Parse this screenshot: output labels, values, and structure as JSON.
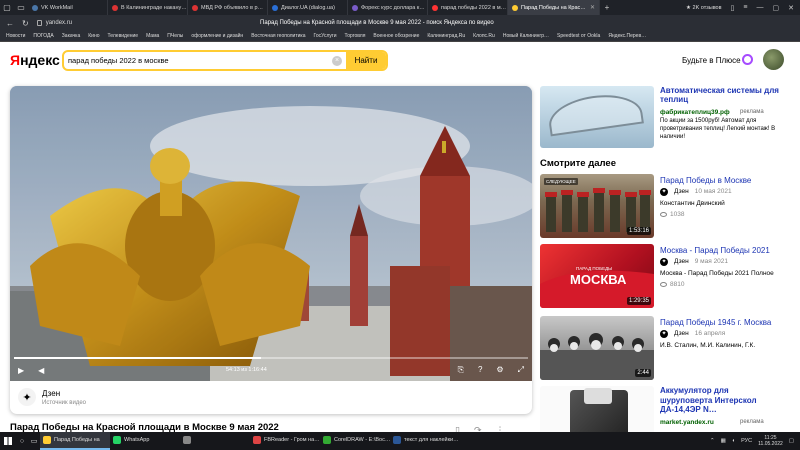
{
  "browser": {
    "tabs": [
      {
        "label": "VK WorkMail",
        "color": "#4a76a8"
      },
      {
        "label": "В Калининграде накану…",
        "color": "#d33"
      },
      {
        "label": "МВД РФ объявило в р…",
        "color": "#d33"
      },
      {
        "label": "Диалог.UA (dialog.ua)",
        "color": "#2a6fd6"
      },
      {
        "label": "Форекс курс доллара к…",
        "color": "#7a5cc9"
      },
      {
        "label": "парад победы 2022 в м…",
        "color": "#f33"
      },
      {
        "label": "Парад Победы на Крас…",
        "color": "#fc3"
      }
    ],
    "rating": "★ 2K отзывов",
    "url": "yandex.ru",
    "page_title": "Парад Победы на Красной площади в Москве 9 мая 2022 - поиск Яндекса по видео",
    "bookmarks": [
      "Новости",
      "ПОГОДА",
      "Закачка",
      "Кино",
      "Телевидение",
      "Мама",
      "ПЧелы",
      "оформление и дизайн",
      "Восточная геополитика",
      "ГосУслуги",
      "Торговля",
      "Военное обозрение",
      "Калининград.Ru",
      "Клопс.Ru",
      "Новый Калинингр…",
      "Speedtest от Ookla",
      "Яндекс.Перев…"
    ]
  },
  "header": {
    "logo_first": "Я",
    "logo_rest": "ндекс",
    "search_value": "парад победы 2022 в москве",
    "search_button": "Найти",
    "plus_label": "Будьте в Плюсе"
  },
  "video": {
    "time": "54:13 из 1:16:44",
    "progress": 0.48,
    "source_name": "Дзен",
    "source_sub": "Источник видео",
    "title": "Парад Победы на Красной площади в Москве 9 мая 2022"
  },
  "sidebar": {
    "ad": {
      "title": "Автоматическая системы для теплиц",
      "site": "фабрикатеплиц39.рф",
      "badge": "реклама",
      "text": "По акции за 1500руб! Автомат для проветривания теплиц! Легкий монтаж! В наличии!"
    },
    "section_title": "Смотрите далее",
    "recommendations": [
      {
        "title": "Парад Победы в Москве",
        "source": "Дзен",
        "date": "10 мая 2021",
        "author": "Константин Двинский",
        "views": "1038",
        "duration": "1:53:16",
        "badge": "СЛЕДУЮЩЕЕ"
      },
      {
        "title": "Москва - Парад Победы 2021",
        "source": "Дзен",
        "date": "9 мая 2021",
        "author": "Москва - Парад Победы 2021 Полное",
        "views": "8810",
        "duration": "1:29:35",
        "badge": ""
      },
      {
        "title": "Парад Победы 1945 г. Москва",
        "source": "Дзен",
        "date": "16 апреля",
        "author": "И.В. Сталин, М.И. Калинин, Г.К.",
        "views": "",
        "duration": "2:44",
        "badge": ""
      }
    ],
    "shop": {
      "title": "Аккумулятор для шуруповерта Интерскол ДА-14,4ЭР N…",
      "site": "market.yandex.ru",
      "badge": "реклама"
    }
  },
  "taskbar": {
    "items": [
      {
        "label": "Парад Победы на",
        "color": "#fc3"
      },
      {
        "label": "WhatsApp",
        "color": "#25d366"
      },
      {
        "label": "",
        "color": "#888"
      },
      {
        "label": "FBReader - Гром на…",
        "color": "#d44"
      },
      {
        "label": "CorelDRAW - E:\\Вос…",
        "color": "#3a3"
      },
      {
        "label": "текст для наклейки…",
        "color": "#2b5797"
      }
    ],
    "lang": "РУС",
    "time": "11:25",
    "date": "11.05.2022"
  }
}
